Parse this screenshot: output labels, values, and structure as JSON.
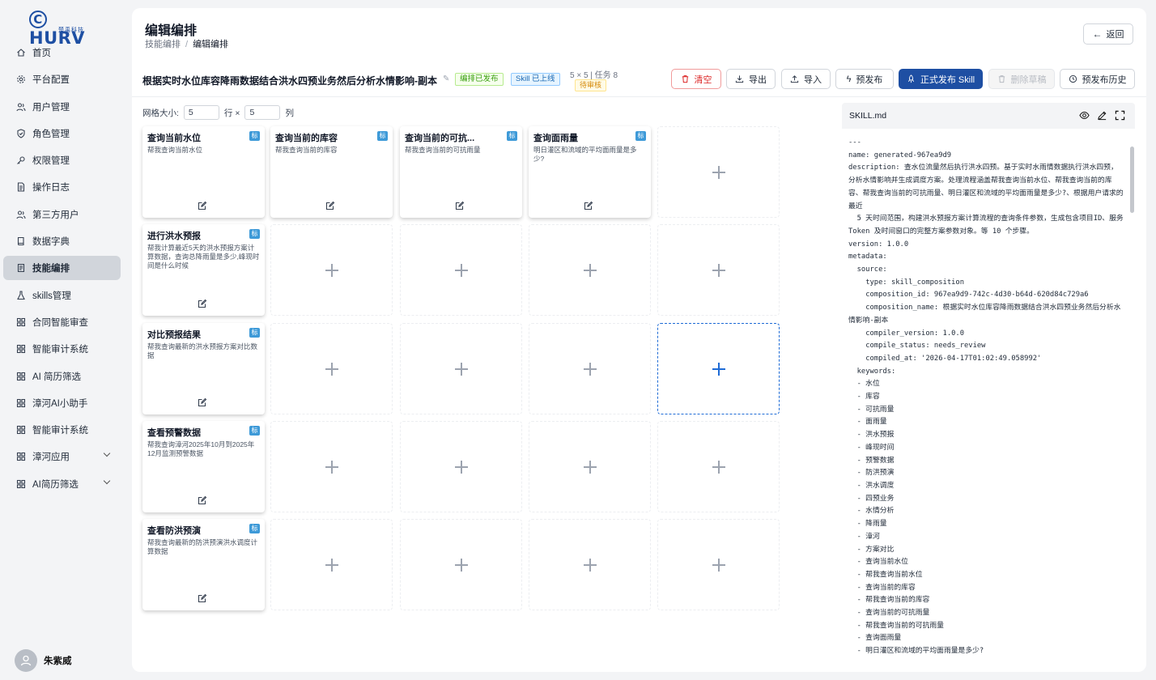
{
  "logo": {
    "brand": "HURV",
    "sub": "楚禹科技"
  },
  "nav": [
    {
      "label": "首页",
      "icon": "home-icon"
    },
    {
      "label": "平台配置",
      "icon": "settings-icon"
    },
    {
      "label": "用户管理",
      "icon": "users-icon"
    },
    {
      "label": "角色管理",
      "icon": "shield-icon"
    },
    {
      "label": "权限管理",
      "icon": "key-icon"
    },
    {
      "label": "操作日志",
      "icon": "log-icon"
    },
    {
      "label": "第三方用户",
      "icon": "users-icon"
    },
    {
      "label": "数据字典",
      "icon": "book-icon"
    },
    {
      "label": "技能编排",
      "icon": "skill-icon",
      "active": true
    },
    {
      "label": "skills管理",
      "icon": "flask-icon"
    },
    {
      "label": "合同智能审查",
      "icon": "grid-icon"
    },
    {
      "label": "智能审计系统",
      "icon": "grid-icon"
    },
    {
      "label": "AI 简历筛选",
      "icon": "grid-icon"
    },
    {
      "label": "漳河AI小助手",
      "icon": "grid-icon"
    },
    {
      "label": "智能审计系统",
      "icon": "grid-icon"
    },
    {
      "label": "漳河应用",
      "icon": "grid-icon",
      "expandable": true
    },
    {
      "label": "AI简历筛选",
      "icon": "grid-icon",
      "expandable": true
    }
  ],
  "user": {
    "name": "朱紫威"
  },
  "header": {
    "title": "编辑编排",
    "breadcrumb": [
      "技能编排",
      "编辑编排"
    ],
    "back_label": "返回"
  },
  "toolbar": {
    "skill_title": "根据实时水位库容降雨数据结合洪水四预业务然后分析水情影响-副本",
    "tag_published": "编排已发布",
    "tag_online": "Skill 已上线",
    "meta": "5 × 5 | 任务 8",
    "tag_review": "待审核",
    "clear": "清空",
    "export": "导出",
    "import": "导入",
    "prepublish": "预发布",
    "publish": "正式发布 Skill",
    "delete_draft": "删除草稿",
    "history": "预发布历史"
  },
  "grid_size": {
    "label": "网格大小:",
    "rows": "5",
    "rows_label": "行 ×",
    "cols": "5",
    "cols_label": "列"
  },
  "cards": [
    {
      "row": 0,
      "col": 0,
      "title": "查询当前水位",
      "badge": "标",
      "desc": "帮我查询当前水位"
    },
    {
      "row": 0,
      "col": 1,
      "title": "查询当前的库容",
      "badge": "标",
      "desc": "帮我查询当前的库容"
    },
    {
      "row": 0,
      "col": 2,
      "title": "查询当前的可抗...",
      "badge": "标",
      "desc": "帮我查询当前的可抗雨量"
    },
    {
      "row": 0,
      "col": 3,
      "title": "查询面雨量",
      "badge": "标",
      "desc": "明日灌区和流域的平均面雨量是多少?"
    },
    {
      "row": 1,
      "col": 0,
      "title": "进行洪水预报",
      "badge": "标",
      "desc": "帮我计算最近5天的洪水预报方案计算数据，查询总降雨量是多少,峰现时间是什么时候"
    },
    {
      "row": 2,
      "col": 0,
      "title": "对比预报结果",
      "badge": "标",
      "desc": "帮我查询最新的洪水预报方案对比数据"
    },
    {
      "row": 3,
      "col": 0,
      "title": "查看预警数据",
      "badge": "标",
      "desc": "帮我查询漳河2025年10月到2025年12月监测预警数据"
    },
    {
      "row": 4,
      "col": 0,
      "title": "查看防洪预演",
      "badge": "标",
      "desc": "帮我查询最新的防洪预演洪水调度计算数据"
    }
  ],
  "highlighted_cell": {
    "row": 2,
    "col": 4
  },
  "panel": {
    "filename": "SKILL.md",
    "content": "---\nname: generated-967ea9d9\ndescription: 查水位流量然后执行洪水四预。基于实时水雨情数据执行洪水四预，分析水情影响并生成调度方案。处理流程涵盖帮我查询当前水位、帮我查询当前的库容、帮我查询当前的可抗雨量、明日灌区和流域的平均面雨量是多少?、根据用户请求的最近\n  5 天时间范围，构建洪水预报方案计算流程的查询条件参数，生成包含项目ID、服务 Token 及时间窗口的完整方案参数对象。等 10 个步骤。\nversion: 1.0.0\nmetadata:\n  source:\n    type: skill_composition\n    composition_id: 967ea9d9-742c-4d30-b64d-620d84c729a6\n    composition_name: 根据实时水位库容降雨数据结合洪水四预业务然后分析水情影响-副本\n    compiler_version: 1.0.0\n    compile_status: needs_review\n    compiled_at: '2026-04-17T01:02:49.058992'\n  keywords:\n  - 水位\n  - 库容\n  - 可抗雨量\n  - 面雨量\n  - 洪水预报\n  - 峰现时间\n  - 预警数据\n  - 防洪预演\n  - 洪水调度\n  - 四预业务\n  - 水情分析\n  - 降雨量\n  - 漳河\n  - 方案对比\n  - 查询当前水位\n  - 帮我查询当前水位\n  - 查询当前的库容\n  - 帮我查询当前的库容\n  - 查询当前的可抗雨量\n  - 帮我查询当前的可抗雨量\n  - 查询面雨量\n  - 明日灌区和流域的平均面雨量是多少?"
  }
}
